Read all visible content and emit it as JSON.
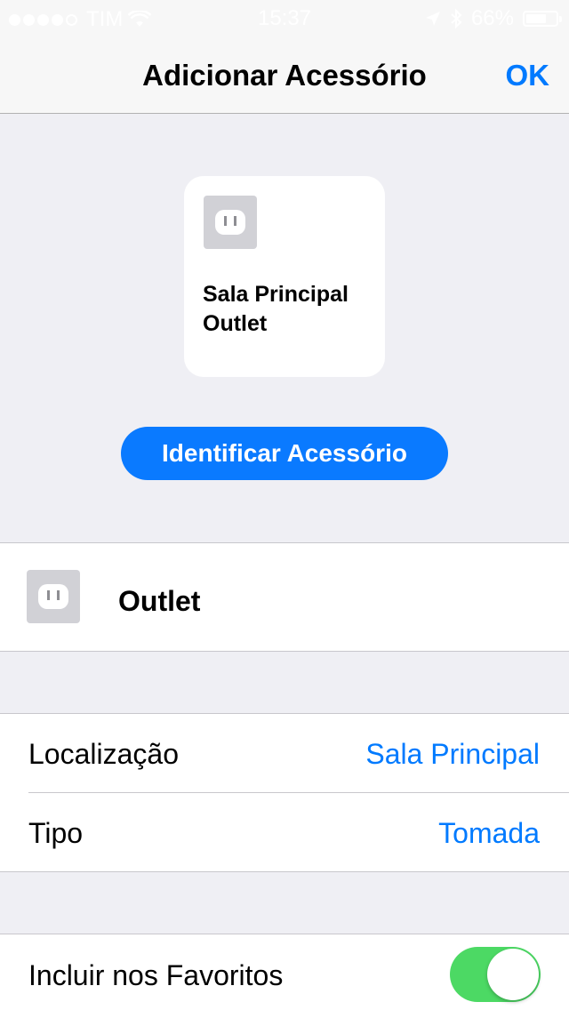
{
  "status_bar": {
    "carrier": "TIM",
    "time": "15:37",
    "battery": "66%",
    "battery_level": 0.66,
    "icons": [
      "signal-icon",
      "wifi-icon",
      "location-arrow-icon",
      "bluetooth-icon",
      "battery-icon"
    ]
  },
  "nav": {
    "title": "Adicionar Acessório",
    "ok_label": "OK"
  },
  "tile": {
    "name_line1": "Sala Principal",
    "name_line2": "Outlet",
    "icon": "outlet-icon"
  },
  "identify_button": "Identificar Acessório",
  "accessory_name": "Outlet",
  "settings": {
    "location_label": "Localização",
    "location_value": "Sala Principal",
    "type_label": "Tipo",
    "type_value": "Tomada"
  },
  "favorites": {
    "label": "Incluir nos Favoritos",
    "enabled": true
  },
  "colors": {
    "accent": "#007aff",
    "button": "#0a7aff",
    "toggle_on": "#4cd964",
    "background": "#efeff4"
  }
}
